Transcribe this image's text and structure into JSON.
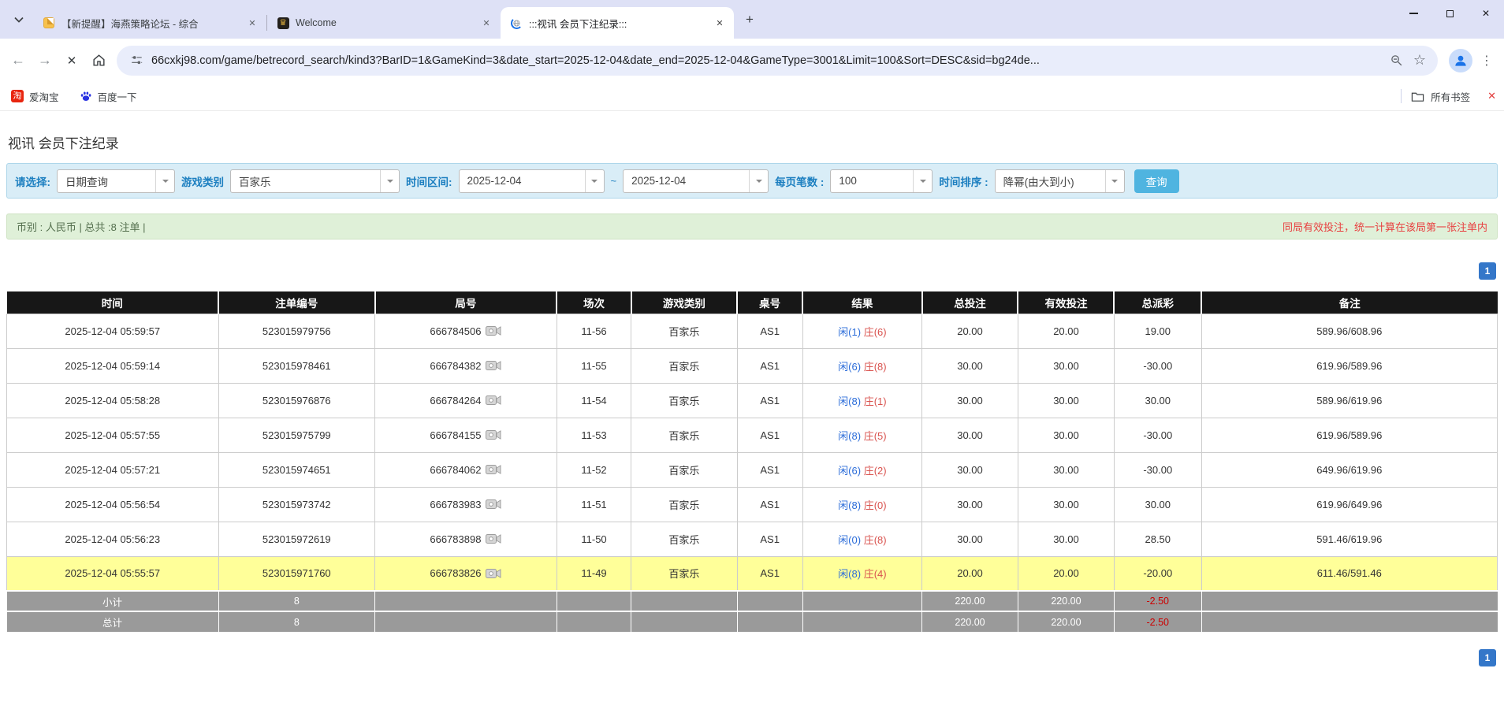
{
  "browser": {
    "tabs": [
      {
        "title": "【新提醒】海燕策略论坛 - 综合",
        "favicon": "note-icon"
      },
      {
        "title": "Welcome",
        "favicon": "dark-emblem-icon"
      },
      {
        "title": ":::视讯 会员下注纪录:::",
        "favicon": "loading-spinner-icon",
        "active": true
      }
    ],
    "url": "66cxkj98.com/game/betrecord_search/kind3?BarID=1&GameKind=3&date_start=2025-12-04&date_end=2025-12-04&GameType=3001&Limit=100&Sort=DESC&sid=bg24de...",
    "bookmarks": {
      "items": [
        {
          "label": "爱淘宝",
          "icon": "taobao-icon",
          "icon_glyph": "淘"
        },
        {
          "label": "百度一下",
          "icon": "baidu-paw-icon"
        }
      ],
      "all_bookmarks_label": "所有书签"
    }
  },
  "icons": {
    "back": "←",
    "forward": "→",
    "stop": "✕",
    "star": "☆",
    "menu": "⋮",
    "close": "✕",
    "new_tab": "+",
    "emblem": "♛"
  },
  "page": {
    "title": "视讯 会员下注纪录",
    "filters": {
      "select_label": "请选择:",
      "select_value": "日期查询",
      "game_category_label": "游戏类别",
      "game_category_value": "百家乐",
      "date_range_label": "时间区间:",
      "date_start": "2025-12-04",
      "range_separator": "~",
      "date_end": "2025-12-04",
      "page_size_label": "每页笔数 :",
      "page_size_value": "100",
      "sort_label": "时间排序 :",
      "sort_value": "降幂(由大到小)",
      "search_button": "查询"
    },
    "info_bar": {
      "left": "币别 : 人民币 | 总共 :8 注单 |",
      "right": "同局有效投注，统一计算在该局第一张注单内"
    },
    "pagination": {
      "page": "1"
    },
    "table": {
      "headers": [
        "时间",
        "注单编号",
        "局号",
        "场次",
        "游戏类别",
        "桌号",
        "结果",
        "总投注",
        "有效投注",
        "总派彩",
        "备注"
      ],
      "rows": [
        {
          "time": "2025-12-04 05:59:57",
          "bet_id": "523015979756",
          "round": "666784506",
          "session": "11-56",
          "game": "百家乐",
          "table_no": "AS1",
          "result_player": "闲(1)",
          "result_banker": "庄(6)",
          "total_bet": "20.00",
          "valid_bet": "20.00",
          "payout": "19.00",
          "remark": "589.96/608.96",
          "highlight": false
        },
        {
          "time": "2025-12-04 05:59:14",
          "bet_id": "523015978461",
          "round": "666784382",
          "session": "11-55",
          "game": "百家乐",
          "table_no": "AS1",
          "result_player": "闲(6)",
          "result_banker": "庄(8)",
          "total_bet": "30.00",
          "valid_bet": "30.00",
          "payout": "-30.00",
          "remark": "619.96/589.96",
          "highlight": false
        },
        {
          "time": "2025-12-04 05:58:28",
          "bet_id": "523015976876",
          "round": "666784264",
          "session": "11-54",
          "game": "百家乐",
          "table_no": "AS1",
          "result_player": "闲(8)",
          "result_banker": "庄(1)",
          "total_bet": "30.00",
          "valid_bet": "30.00",
          "payout": "30.00",
          "remark": "589.96/619.96",
          "highlight": false
        },
        {
          "time": "2025-12-04 05:57:55",
          "bet_id": "523015975799",
          "round": "666784155",
          "session": "11-53",
          "game": "百家乐",
          "table_no": "AS1",
          "result_player": "闲(8)",
          "result_banker": "庄(5)",
          "total_bet": "30.00",
          "valid_bet": "30.00",
          "payout": "-30.00",
          "remark": "619.96/589.96",
          "highlight": false
        },
        {
          "time": "2025-12-04 05:57:21",
          "bet_id": "523015974651",
          "round": "666784062",
          "session": "11-52",
          "game": "百家乐",
          "table_no": "AS1",
          "result_player": "闲(6)",
          "result_banker": "庄(2)",
          "total_bet": "30.00",
          "valid_bet": "30.00",
          "payout": "-30.00",
          "remark": "649.96/619.96",
          "highlight": false
        },
        {
          "time": "2025-12-04 05:56:54",
          "bet_id": "523015973742",
          "round": "666783983",
          "session": "11-51",
          "game": "百家乐",
          "table_no": "AS1",
          "result_player": "闲(8)",
          "result_banker": "庄(0)",
          "total_bet": "30.00",
          "valid_bet": "30.00",
          "payout": "30.00",
          "remark": "619.96/649.96",
          "highlight": false
        },
        {
          "time": "2025-12-04 05:56:23",
          "bet_id": "523015972619",
          "round": "666783898",
          "session": "11-50",
          "game": "百家乐",
          "table_no": "AS1",
          "result_player": "闲(0)",
          "result_banker": "庄(8)",
          "total_bet": "30.00",
          "valid_bet": "30.00",
          "payout": "28.50",
          "remark": "591.46/619.96",
          "highlight": false
        },
        {
          "time": "2025-12-04 05:55:57",
          "bet_id": "523015971760",
          "round": "666783826",
          "session": "11-49",
          "game": "百家乐",
          "table_no": "AS1",
          "result_player": "闲(8)",
          "result_banker": "庄(4)",
          "total_bet": "20.00",
          "valid_bet": "20.00",
          "payout": "-20.00",
          "remark": "611.46/591.46",
          "highlight": true
        }
      ],
      "summary_rows": [
        {
          "label": "小计",
          "count": "8",
          "total_bet": "220.00",
          "valid_bet": "220.00",
          "payout": "-2.50"
        },
        {
          "label": "总计",
          "count": "8",
          "total_bet": "220.00",
          "valid_bet": "220.00",
          "payout": "-2.50"
        }
      ]
    }
  },
  "colors": {
    "accent_blue": "#1c7fc0",
    "search_button": "#4fb4e0",
    "filter_bg": "#d9edf7",
    "info_bg": "#dff0d8",
    "info_red": "#e84040",
    "highlight_row": "#ffff99",
    "summary_gray": "#9a9a9a",
    "pagination_blue": "#3477c9",
    "link_blue": "#0a6cd6",
    "result_blue": "#2b6cd9",
    "result_red": "#d9534f",
    "negative_red": "#e60000"
  }
}
